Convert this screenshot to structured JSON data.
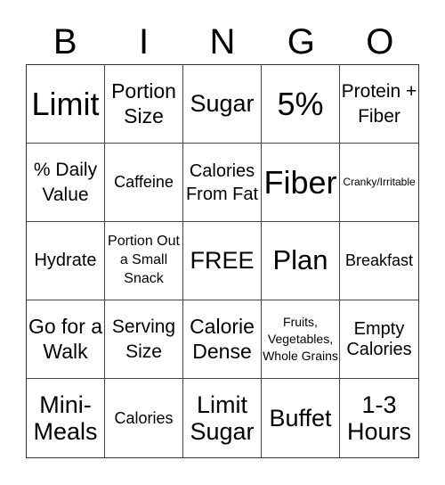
{
  "header": {
    "letters": [
      "B",
      "I",
      "N",
      "G",
      "O"
    ]
  },
  "cells": [
    [
      "Limit",
      "Portion Size",
      "Sugar",
      "5%",
      "Protein + Fiber"
    ],
    [
      "% Daily Value",
      "Caffeine",
      "Calories From Fat",
      "Fiber",
      "Cranky/Irritable"
    ],
    [
      "Hydrate",
      "Portion Out a Small Snack",
      "FREE",
      "Plan",
      "Breakfast"
    ],
    [
      "Go for a Walk",
      "Serving Size",
      "Calorie Dense",
      "Fruits, Vegetables, Whole Grains",
      "Empty Calories"
    ],
    [
      "Mini-Meals",
      "Calories",
      "Limit Sugar",
      "Buffet",
      "1-3 Hours"
    ]
  ]
}
